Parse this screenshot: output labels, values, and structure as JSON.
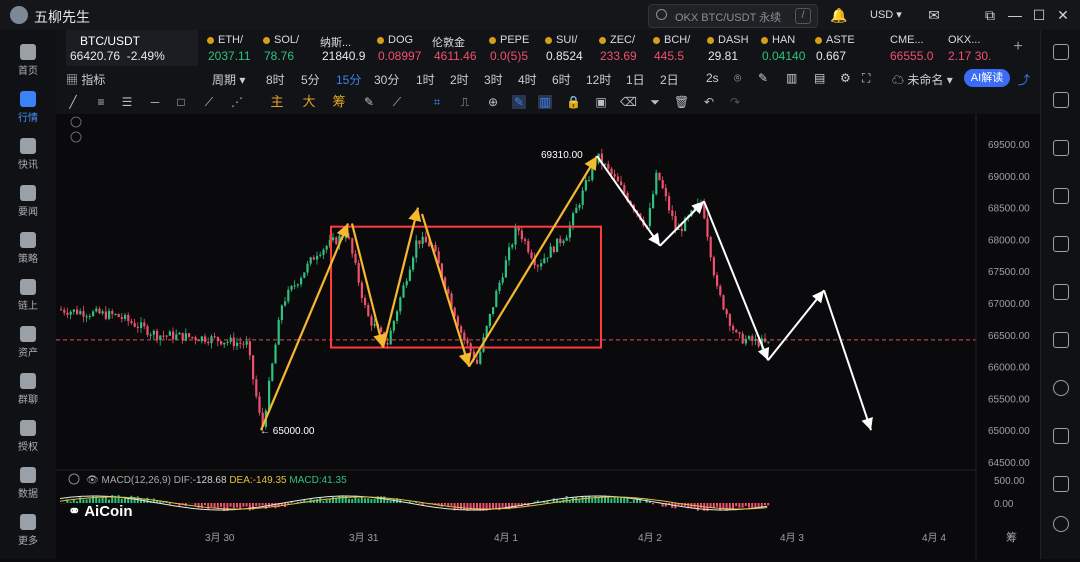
{
  "app": {
    "title": "五柳先生"
  },
  "search": {
    "placeholder": "OKX BTC/USDT 永续",
    "shortcut": "/"
  },
  "currency": "USD",
  "nav": [
    {
      "label": "首页"
    },
    {
      "label": "行情"
    },
    {
      "label": "快讯"
    },
    {
      "label": "要闻"
    },
    {
      "label": "策略"
    },
    {
      "label": "链上"
    },
    {
      "label": "资产"
    },
    {
      "label": "群聊"
    },
    {
      "label": "授权"
    },
    {
      "label": "数据"
    },
    {
      "label": "更多"
    }
  ],
  "tickers": [
    {
      "name": "BTC/USDT",
      "price": "66420.76",
      "change": "-2.49%"
    },
    {
      "name": "ETH/",
      "price": "2037.11"
    },
    {
      "name": "SOL/",
      "price": "78.76"
    },
    {
      "name": "纳斯...",
      "price": "21840.9"
    },
    {
      "name": "DOG",
      "price": "0.08997"
    },
    {
      "name": "伦敦金",
      "price": "4611.46"
    },
    {
      "name": "PEPE",
      "price": "0.0(5)5"
    },
    {
      "name": "SUI/",
      "price": "0.8524"
    },
    {
      "name": "ZEC/",
      "price": "233.69"
    },
    {
      "name": "BCH/",
      "price": "445.5"
    },
    {
      "name": "DASH",
      "price": "29.81"
    },
    {
      "name": "HAN",
      "price": "0.04140"
    },
    {
      "name": "ASTE",
      "price": "0.667"
    },
    {
      "name": "CME...",
      "price": "66555.0"
    },
    {
      "name": "OKX...",
      "price": "2.17 30."
    }
  ],
  "timeframes": {
    "indicator": "指标",
    "period": "周期",
    "items": [
      "8时",
      "5分",
      "15分",
      "30分",
      "1时",
      "2时",
      "3时",
      "4时",
      "6时",
      "12时",
      "1日",
      "2日"
    ],
    "selected": "15分",
    "extra": "2s",
    "account": "未命名",
    "ai": "AI解读"
  },
  "drawing_tools": {
    "zhu": "主",
    "da": "大",
    "chou": "筹"
  },
  "chart_data": {
    "type": "candlestick",
    "pair": "BTC/USDT",
    "ylim": [
      64500,
      69500
    ],
    "yticks": [
      "69500.00",
      "69000.00",
      "68500.00",
      "68000.00",
      "67500.00",
      "67000.00",
      "66500.00",
      "66000.00",
      "65500.00",
      "65000.00",
      "64500.00"
    ],
    "xticks": [
      "3月 30",
      "3月 31",
      "4月 1",
      "4月 2",
      "4月 3",
      "4月 4"
    ],
    "annotations": {
      "high": "69310.00",
      "low": "← 65000.00"
    },
    "current_price_line": 66420,
    "range_box": {
      "high": 68200,
      "low": 66300
    },
    "macd": {
      "label": "MACD(12,26,9)",
      "dif_label": "DIF:",
      "dif": "-128.68",
      "dea_label": "DEA:",
      "dea": "-149.35",
      "macd_label": "MACD:",
      "macd": "41.35",
      "yticks": [
        "500.00",
        "0.00"
      ]
    },
    "watermark": "AiCoin"
  },
  "colors": {
    "up": "#2ec27e",
    "down": "#f0506e",
    "accent": "#3b82f6",
    "box": "#ff3b3b",
    "arrow_yellow": "#f5b82e"
  }
}
